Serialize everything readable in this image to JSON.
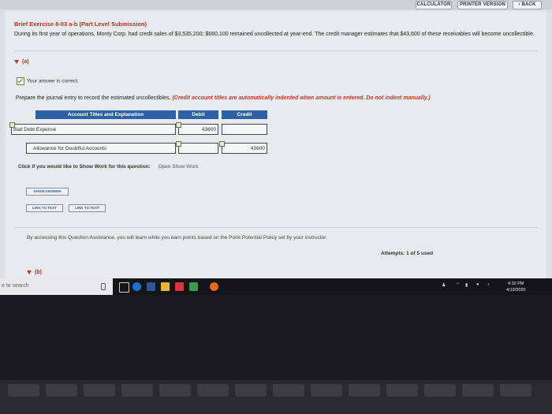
{
  "topbar": {
    "calculator": "CALCULATOR",
    "printer_version": "PRINTER VERSION",
    "back": "‹ BACK"
  },
  "exercise": {
    "title": "Brief Exercise 8-03 a-b (Part Level Submission)",
    "description": "During its first year of operations, Monty Corp. had credit sales of $3,535,200; $660,100 remained uncollected at year-end. The credit manager estimates that $43,600 of these receivables will become uncollectible.",
    "part_a_label": "(a)",
    "correct_message": "Your answer is correct.",
    "prompt": "Prepare the journal entry to record the estimated uncollectibles.",
    "prompt_hint": "(Credit account titles are automatically indented when amount is entered. Do not indent manually.)",
    "journal": {
      "headers": {
        "account": "Account Titles and Explanation",
        "debit": "Debit",
        "credit": "Credit"
      },
      "rows": [
        {
          "account": "Bad Debt Expense",
          "debit": "43600",
          "credit": ""
        },
        {
          "account": "Allowance for Doubtful Accounts",
          "debit": "",
          "credit": "43600"
        }
      ]
    },
    "show_work_question": "Click if you would like to Show Work for this question:",
    "show_work_link": "Open Show Work",
    "show_answer": "SHOW ANSWER",
    "link_to_text_1": "LINK TO TEXT",
    "link_to_text_2": "LINK TO TEXT",
    "assistance_note": "By accessing this Question Assistance, you will learn while you earn points based on the Point Potential Policy set by your instructor.",
    "attempts": "Attempts: 1 of 5 used",
    "part_b_label": "(b)"
  },
  "taskbar": {
    "search_text": "e to search",
    "time": "4:32 PM",
    "date": "4/19/2020"
  },
  "colors": {
    "accent": "#2c61a7",
    "heading": "#b0331e",
    "hint": "#c0392b"
  }
}
